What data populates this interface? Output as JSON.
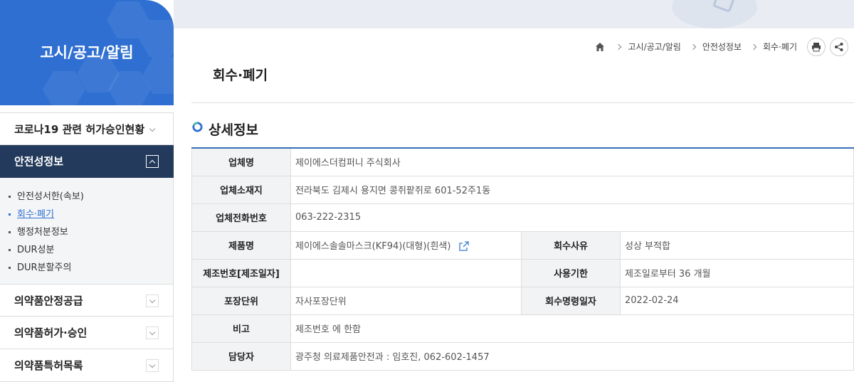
{
  "sidebar": {
    "title": "고시/공고/알림",
    "menu": [
      {
        "label": "코로나19 관련 허가승인현황"
      },
      {
        "label": "안전성정보"
      },
      {
        "label": "의약품안정공급"
      },
      {
        "label": "의약품허가·승인"
      },
      {
        "label": "의약품특허목록"
      }
    ],
    "submenu": [
      "안전성서한(속보)",
      "회수·폐기",
      "행정처분정보",
      "DUR성분",
      "DUR분할주의"
    ]
  },
  "breadcrumb": [
    "고시/공고/알림",
    "안전성정보",
    "회수·폐기"
  ],
  "page_title": "회수·폐기",
  "section_title": "상세정보",
  "detail": {
    "company_label": "업체명",
    "company": "제이에스더컴퍼니 주식회사",
    "address_label": "업체소재지",
    "address": "전라북도 김제시 용지면 콩쥐팥쥐로 601-52주1동",
    "phone_label": "업체전화번호",
    "phone": "063-222-2315",
    "product_label": "제품명",
    "product": "제이에스솔솔마스크(KF94)(대형)(흰색)",
    "reason_label": "회수사유",
    "reason": "성상 부적합",
    "lot_label": "제조번호[제조일자]",
    "lot": "",
    "expiry_label": "사용기한",
    "expiry": "제조일로부터 36 개월",
    "pack_label": "포장단위",
    "pack": "자사포장단위",
    "order_date_label": "회수명령일자",
    "order_date": "2022-02-24",
    "note_label": "비고",
    "note": "제조번호 에 한함",
    "manager_label": "담당자",
    "manager": "광주청 의료제품안전과 : 임호진, 062-602-1457"
  },
  "colors": {
    "brand": "#2f6fd1",
    "active_menu": "#243a5c",
    "table_top": "#3a6fb5"
  }
}
